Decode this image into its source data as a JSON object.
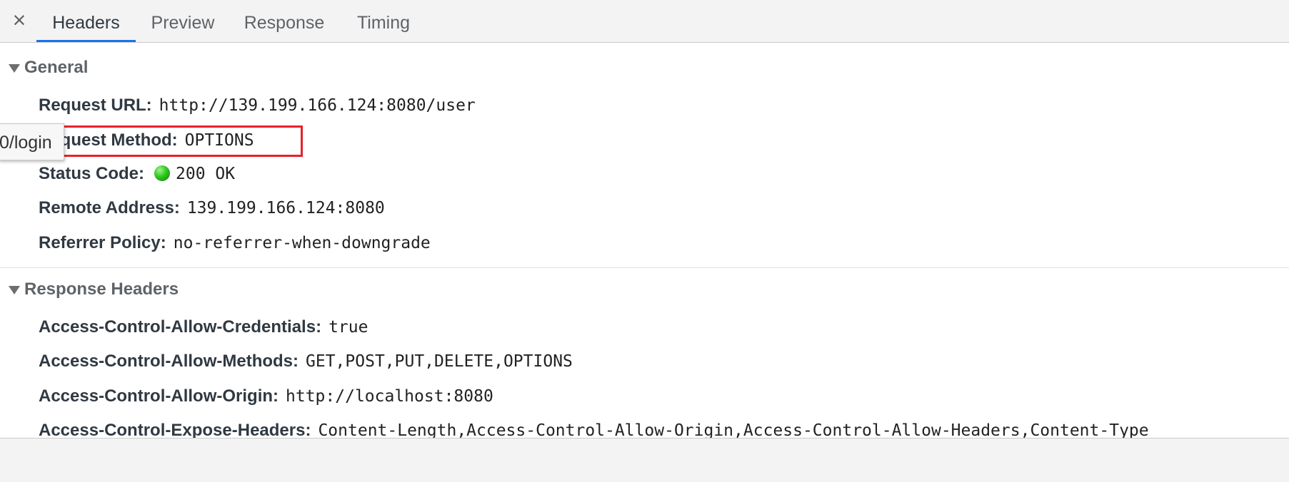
{
  "toolbar": {
    "close_glyph": "×",
    "tabs": [
      {
        "label": "Headers",
        "active": true
      },
      {
        "label": "Preview",
        "active": false
      },
      {
        "label": "Response",
        "active": false
      },
      {
        "label": "Timing",
        "active": false
      }
    ]
  },
  "general": {
    "title": "General",
    "rows": [
      {
        "key": "Request URL:",
        "value": "http://139.199.166.124:8080/user"
      },
      {
        "key": "Request Method:",
        "value": "OPTIONS"
      },
      {
        "key": "Status Code:",
        "value": "200 OK"
      },
      {
        "key": "Remote Address:",
        "value": "139.199.166.124:8080"
      },
      {
        "key": "Referrer Policy:",
        "value": "no-referrer-when-downgrade"
      }
    ]
  },
  "response_headers": {
    "title": "Response Headers",
    "rows": [
      {
        "key": "Access-Control-Allow-Credentials:",
        "value": "true"
      },
      {
        "key": "Access-Control-Allow-Methods:",
        "value": "GET,POST,PUT,DELETE,OPTIONS"
      },
      {
        "key": "Access-Control-Allow-Origin:",
        "value": "http://localhost:8080"
      },
      {
        "key": "Access-Control-Expose-Headers:",
        "value": "Content-Length,Access-Control-Allow-Origin,Access-Control-Allow-Headers,Content-Type"
      }
    ]
  },
  "tooltip": {
    "text": "0/login"
  },
  "colors": {
    "highlight_box": "#e8212b",
    "active_tab_underline": "#1a73e8",
    "status_ok": "#2fc71d"
  },
  "icons": {
    "close": "close-icon",
    "expand": "triangle-down-icon",
    "status": "status-dot-icon"
  }
}
